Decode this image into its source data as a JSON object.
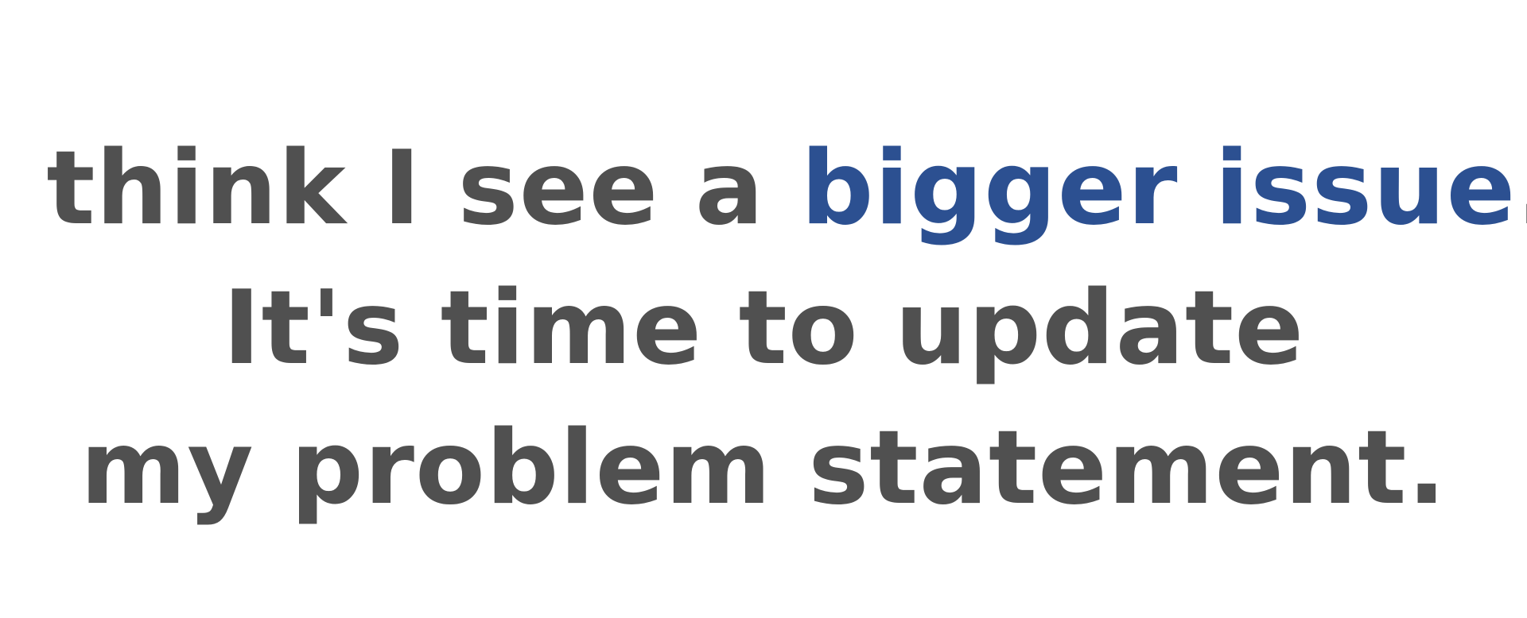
{
  "colors": {
    "text": "#505050",
    "accent": "#2c5091",
    "background": "#ffffff"
  },
  "quote": {
    "line1": {
      "before": "I think I see a ",
      "emphasis": "bigger issue",
      "after": "."
    },
    "line2": "It's time to update",
    "line3": "my problem statement."
  }
}
